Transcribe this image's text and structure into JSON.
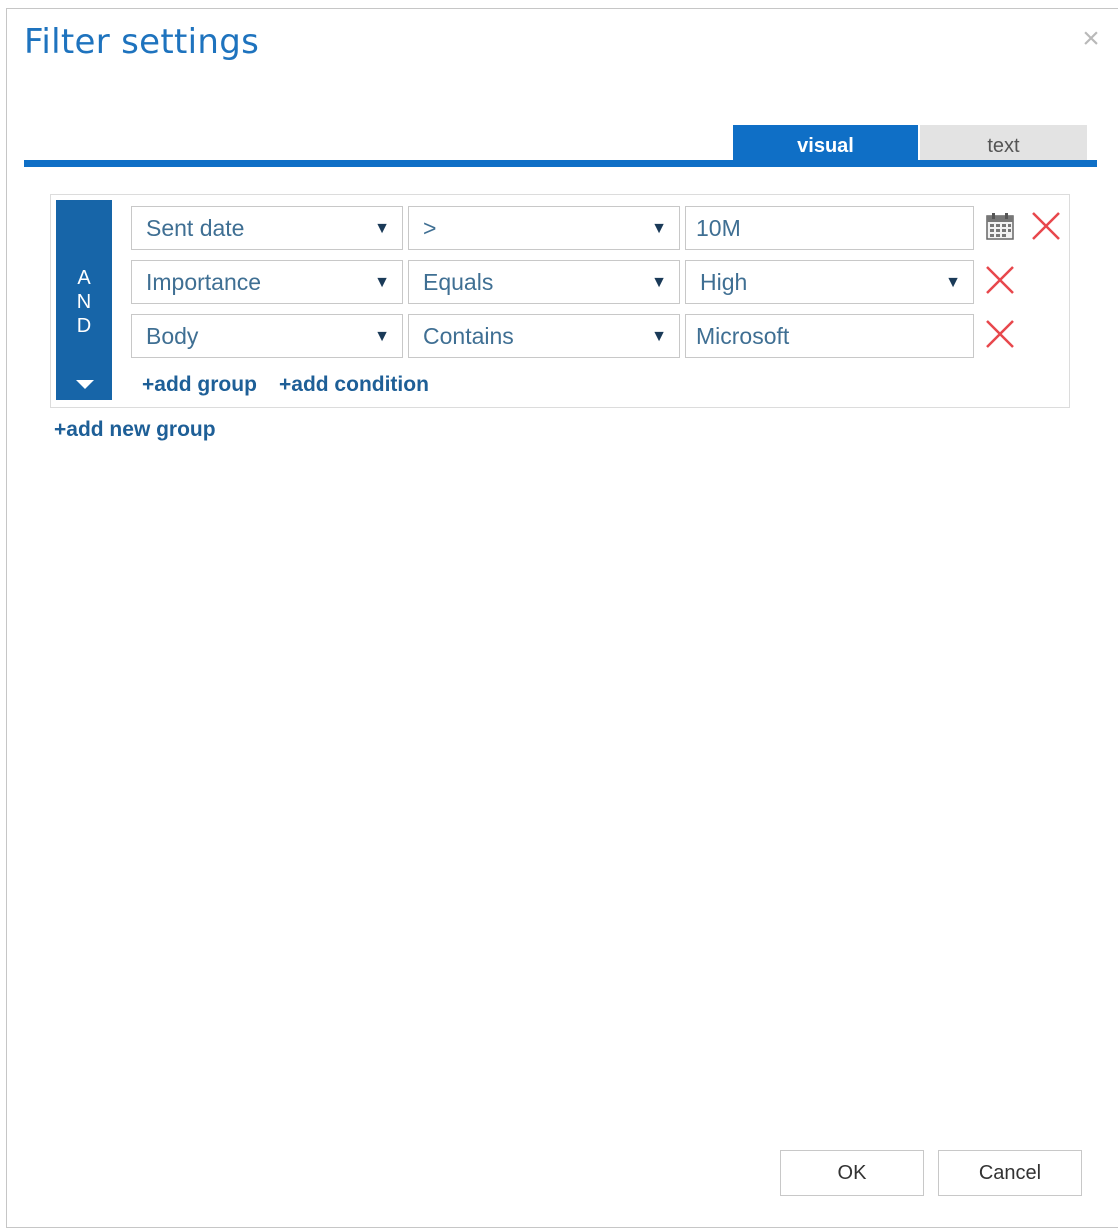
{
  "dialog": {
    "title": "Filter settings",
    "close_label": "×"
  },
  "tabs": [
    {
      "label": "visual",
      "active": true
    },
    {
      "label": "text",
      "active": false
    }
  ],
  "group": {
    "operator_letters": [
      "A",
      "N",
      "D"
    ],
    "conditions": [
      {
        "field": "Sent date",
        "operator": ">",
        "value": "10M",
        "value_type": "input",
        "has_calendar": true
      },
      {
        "field": "Importance",
        "operator": "Equals",
        "value": "High",
        "value_type": "dropdown",
        "has_calendar": false
      },
      {
        "field": "Body",
        "operator": "Contains",
        "value": "Microsoft",
        "value_type": "input",
        "has_calendar": false
      }
    ],
    "add_group_label": "+add group",
    "add_condition_label": "+add condition"
  },
  "add_new_group_label": "+add new group",
  "footer": {
    "ok_label": "OK",
    "cancel_label": "Cancel"
  },
  "colors": {
    "accent": "#0f6fc6",
    "and_bar": "#1765a8",
    "delete": "#e8474c"
  }
}
